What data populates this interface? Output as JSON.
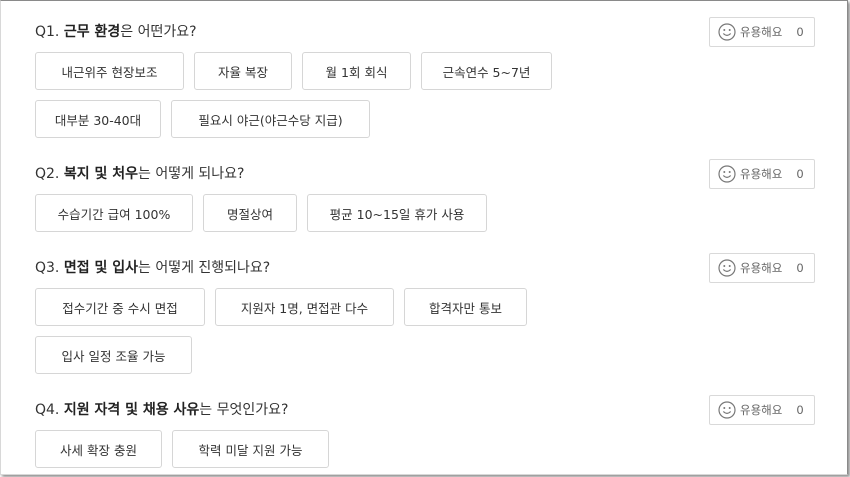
{
  "helpful_label": "유용해요",
  "questions": [
    {
      "prefix": "Q1. ",
      "bold": "근무 환경",
      "suffix": "은 어떤가요?",
      "helpful_count": "0",
      "tags": [
        "내근위주 현장보조",
        "자율 복장",
        "월 1회 회식",
        "근속연수 5~7년",
        "대부분 30-40대",
        "필요시 야근(야근수당 지급)"
      ]
    },
    {
      "prefix": "Q2. ",
      "bold": "복지 및 처우",
      "suffix": "는 어떻게 되나요?",
      "helpful_count": "0",
      "tags": [
        "수습기간 급여 100%",
        "명절상여",
        "평균 10~15일 휴가 사용"
      ]
    },
    {
      "prefix": "Q3. ",
      "bold": "면접 및 입사",
      "suffix": "는 어떻게 진행되나요?",
      "helpful_count": "0",
      "tags": [
        "접수기간 중 수시 면접",
        "지원자 1명, 면접관 다수",
        "합격자만 통보",
        "입사 일정 조율 가능"
      ]
    },
    {
      "prefix": "Q4. ",
      "bold": "지원 자격 및 채용 사유",
      "suffix": "는 무엇인가요?",
      "helpful_count": "0",
      "tags": [
        "사세 확장 충원",
        "학력 미달 지원 가능"
      ]
    }
  ]
}
